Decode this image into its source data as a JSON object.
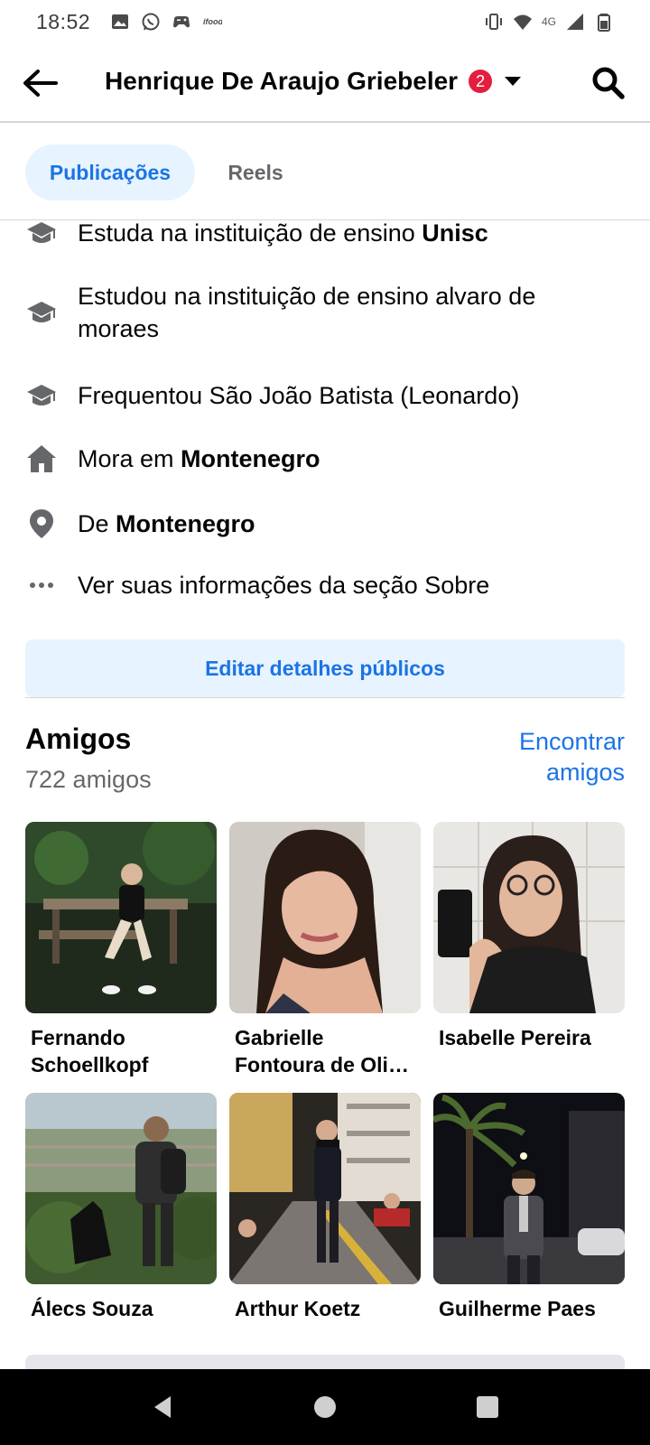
{
  "status_bar": {
    "time": "18:52",
    "network": "4G"
  },
  "header": {
    "title": "Henrique De Araujo Griebeler",
    "badge_count": "2"
  },
  "tabs": [
    {
      "label": "Publicações",
      "active": true
    },
    {
      "label": "Reels",
      "active": false
    }
  ],
  "info": [
    {
      "icon": "graduation-cap-icon",
      "prefix": "Estuda na instituição de ensino ",
      "bold": "Unisc"
    },
    {
      "icon": "graduation-cap-icon",
      "prefix": "Estudou na instituição de ensino alvaro de moraes",
      "bold": ""
    },
    {
      "icon": "graduation-cap-icon",
      "prefix": "Frequentou São João Batista (Leonardo)",
      "bold": ""
    },
    {
      "icon": "home-icon",
      "prefix": "Mora em ",
      "bold": "Montenegro"
    },
    {
      "icon": "location-pin-icon",
      "prefix": "De ",
      "bold": "Montenegro"
    },
    {
      "icon": "more-dots-icon",
      "prefix": "Ver suas informações da seção Sobre",
      "bold": ""
    }
  ],
  "edit_button": "Editar detalhes públicos",
  "friends": {
    "title": "Amigos",
    "count": "722 amigos",
    "find_link": "Encontrar amigos",
    "items": [
      {
        "name": "Fernando Schoellkopf"
      },
      {
        "name": "Gabrielle Fontoura de Oli…"
      },
      {
        "name": "Isabelle Pereira"
      },
      {
        "name": "Álecs Souza"
      },
      {
        "name": "Arthur Koetz"
      },
      {
        "name": "Guilherme Paes"
      }
    ]
  },
  "colors": {
    "accent": "#1b74e4",
    "accent_bg": "#e7f3ff",
    "badge": "#e41e3f",
    "secondary_text": "#65676b"
  }
}
